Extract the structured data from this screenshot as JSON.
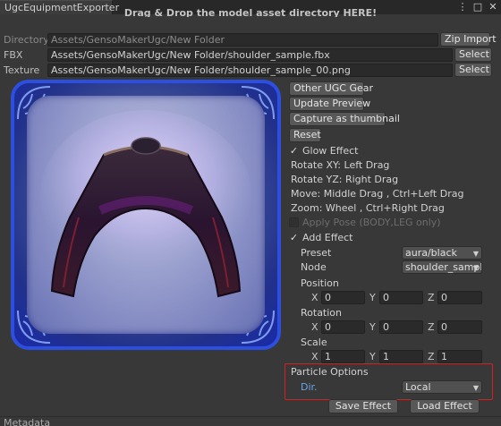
{
  "window": {
    "tab_title": "UgcEquipmentExporter",
    "header_hint": "Drag & Drop the model asset directory HERE!"
  },
  "fields": {
    "directory_label": "Directory",
    "directory_value": "Assets/GensoMakerUgc/New Folder",
    "zip_import_label": "Zip Import",
    "fbx_label": "FBX",
    "fbx_value": "Assets/GensoMakerUgc/New Folder/shoulder_sample.fbx",
    "fbx_select_label": "Select",
    "texture_label": "Texture",
    "texture_value": "Assets/GensoMakerUgc/New Folder/shoulder_sample_00.png",
    "texture_select_label": "Select"
  },
  "actions": {
    "other_ugc_gear": "Other UGC Gear",
    "update_preview": "Update Preview",
    "capture_thumbnail": "Capture as thumbnail",
    "reset": "Reset"
  },
  "options": {
    "glow_effect": "Glow Effect",
    "glow_checked": true,
    "rotate_xy": "Rotate XY: Left Drag",
    "rotate_yz": "Rotate YZ: Right Drag",
    "move": "Move: Middle Drag , Ctrl+Left Drag",
    "zoom": "Zoom: Wheel , Ctrl+Right Drag",
    "apply_pose": "Apply Pose (BODY,LEG only)",
    "apply_pose_checked": false,
    "add_effect": "Add Effect",
    "add_effect_checked": true,
    "check_glyph": "✓"
  },
  "effect": {
    "preset_label": "Preset",
    "preset_value": "aura/black",
    "node_label": "Node",
    "node_value": "shoulder_sampl",
    "position_label": "Position",
    "position": {
      "x": "0",
      "y": "0",
      "z": "0"
    },
    "rotation_label": "Rotation",
    "rotation": {
      "x": "0",
      "y": "0",
      "z": "0"
    },
    "scale_label": "Scale",
    "scale": {
      "x": "1",
      "y": "1",
      "z": "1"
    },
    "axis_x": "X",
    "axis_y": "Y",
    "axis_z": "Z"
  },
  "particle": {
    "title": "Particle Options",
    "dir_label": "Dir.",
    "dir_value": "Local"
  },
  "buttons": {
    "save_effect": "Save Effect",
    "load_effect": "Load Effect"
  },
  "footer": {
    "label": "Metadata"
  },
  "icons": {
    "menu": "⋮",
    "maximize": "□",
    "close": "✕",
    "dropdown_arrow": "▼"
  },
  "colors": {
    "highlight_border": "#d62020",
    "frame_blue": "#2d4fe0",
    "dir_label_blue": "#6ba4e8"
  }
}
